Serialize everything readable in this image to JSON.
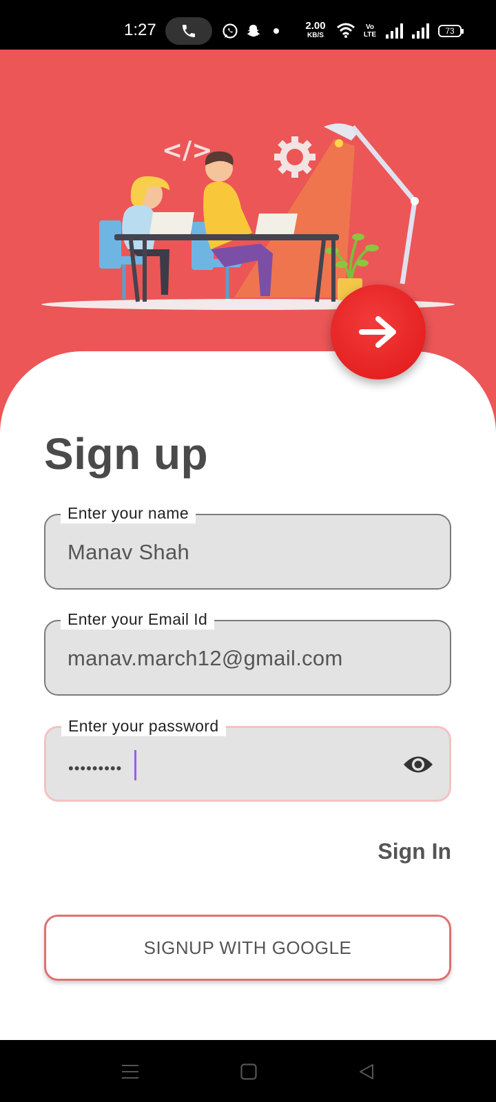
{
  "status_bar": {
    "time": "1:27",
    "net_speed_value": "2.00",
    "net_speed_unit": "KB/S",
    "volte": "Vo LTE",
    "battery": "73",
    "icons": [
      "phone-icon",
      "whatsapp-icon",
      "snapchat-icon",
      "dot-icon",
      "wifi-icon",
      "signal-icon",
      "signal-icon"
    ]
  },
  "hero": {
    "background_color": "#ec5657",
    "illustration": "two-developers-at-desk-illustration"
  },
  "next_button": {
    "icon": "arrow-right-icon",
    "color": "#e01717"
  },
  "form": {
    "title": "Sign up",
    "name_field": {
      "label": "Enter your name",
      "value": "Manav Shah"
    },
    "email_field": {
      "label": "Enter your Email Id",
      "value": "manav.march12@gmail.com"
    },
    "password_field": {
      "label": "Enter your password",
      "masked_value": "•••••••••",
      "icon": "eye-icon"
    },
    "sign_in_label": "Sign In",
    "google_button_label": "SIGNUP WITH GOOGLE"
  },
  "nav_bar": {
    "icons": [
      "menu-icon",
      "home-icon",
      "back-icon"
    ]
  }
}
